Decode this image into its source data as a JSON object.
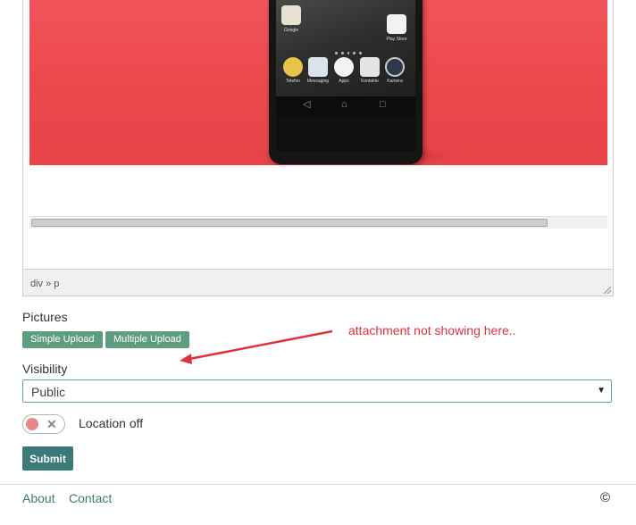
{
  "editor": {
    "path": "div » p",
    "phone_apps": [
      {
        "label": "Google",
        "color": "#e8e0d0"
      },
      {
        "label": "Play Store",
        "color": "#f2f2f2"
      },
      {
        "label": "Telefon",
        "color": "#e8c34a"
      },
      {
        "label": "Messaging",
        "color": "#d9e3ea"
      },
      {
        "label": "Apps",
        "color": "#f3f3f3"
      },
      {
        "label": "Kontakte",
        "color": "#e5e5e5"
      },
      {
        "label": "Kamera",
        "color": "#2b3a4a"
      }
    ],
    "nav_icons": [
      "back-icon",
      "home-icon",
      "recents-icon"
    ]
  },
  "form": {
    "pictures_label": "Pictures",
    "simple_upload_label": "Simple Upload",
    "multiple_upload_label": "Multiple Upload",
    "annotation": "attachment not showing here..",
    "visibility_label": "Visibility",
    "visibility_value": "Public",
    "location_toggle_text": "Location off",
    "submit_label": "Submit"
  },
  "footer": {
    "about_label": "About",
    "contact_label": "Contact",
    "copyright": "©"
  },
  "colors": {
    "accent": "#3b7a78",
    "upload_button": "#5e9e80",
    "annotation": "#e0323c",
    "toggle_off_knob": "#e8878a"
  }
}
